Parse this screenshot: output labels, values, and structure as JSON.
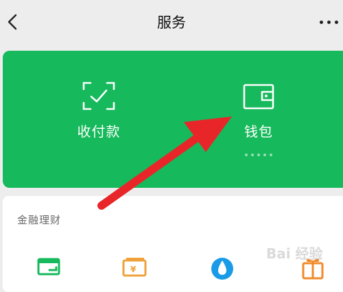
{
  "header": {
    "title": "服务",
    "back_icon": "chevron-left-icon",
    "more_icon": "more-icon"
  },
  "services": [
    {
      "label": "收付款",
      "icon": "scan-check-icon"
    },
    {
      "label": "钱包",
      "icon": "wallet-icon"
    }
  ],
  "finance": {
    "title": "金融理财",
    "items": [
      {
        "icon": "credit-card-icon"
      },
      {
        "icon": "yuan-card-icon"
      },
      {
        "icon": "water-drop-icon"
      },
      {
        "icon": "gift-icon"
      }
    ]
  },
  "annotation": {
    "arrow_color": "#e8262a"
  },
  "watermark": "Bai 经验",
  "colors": {
    "accent": "#16b95b",
    "background": "#ededed"
  }
}
